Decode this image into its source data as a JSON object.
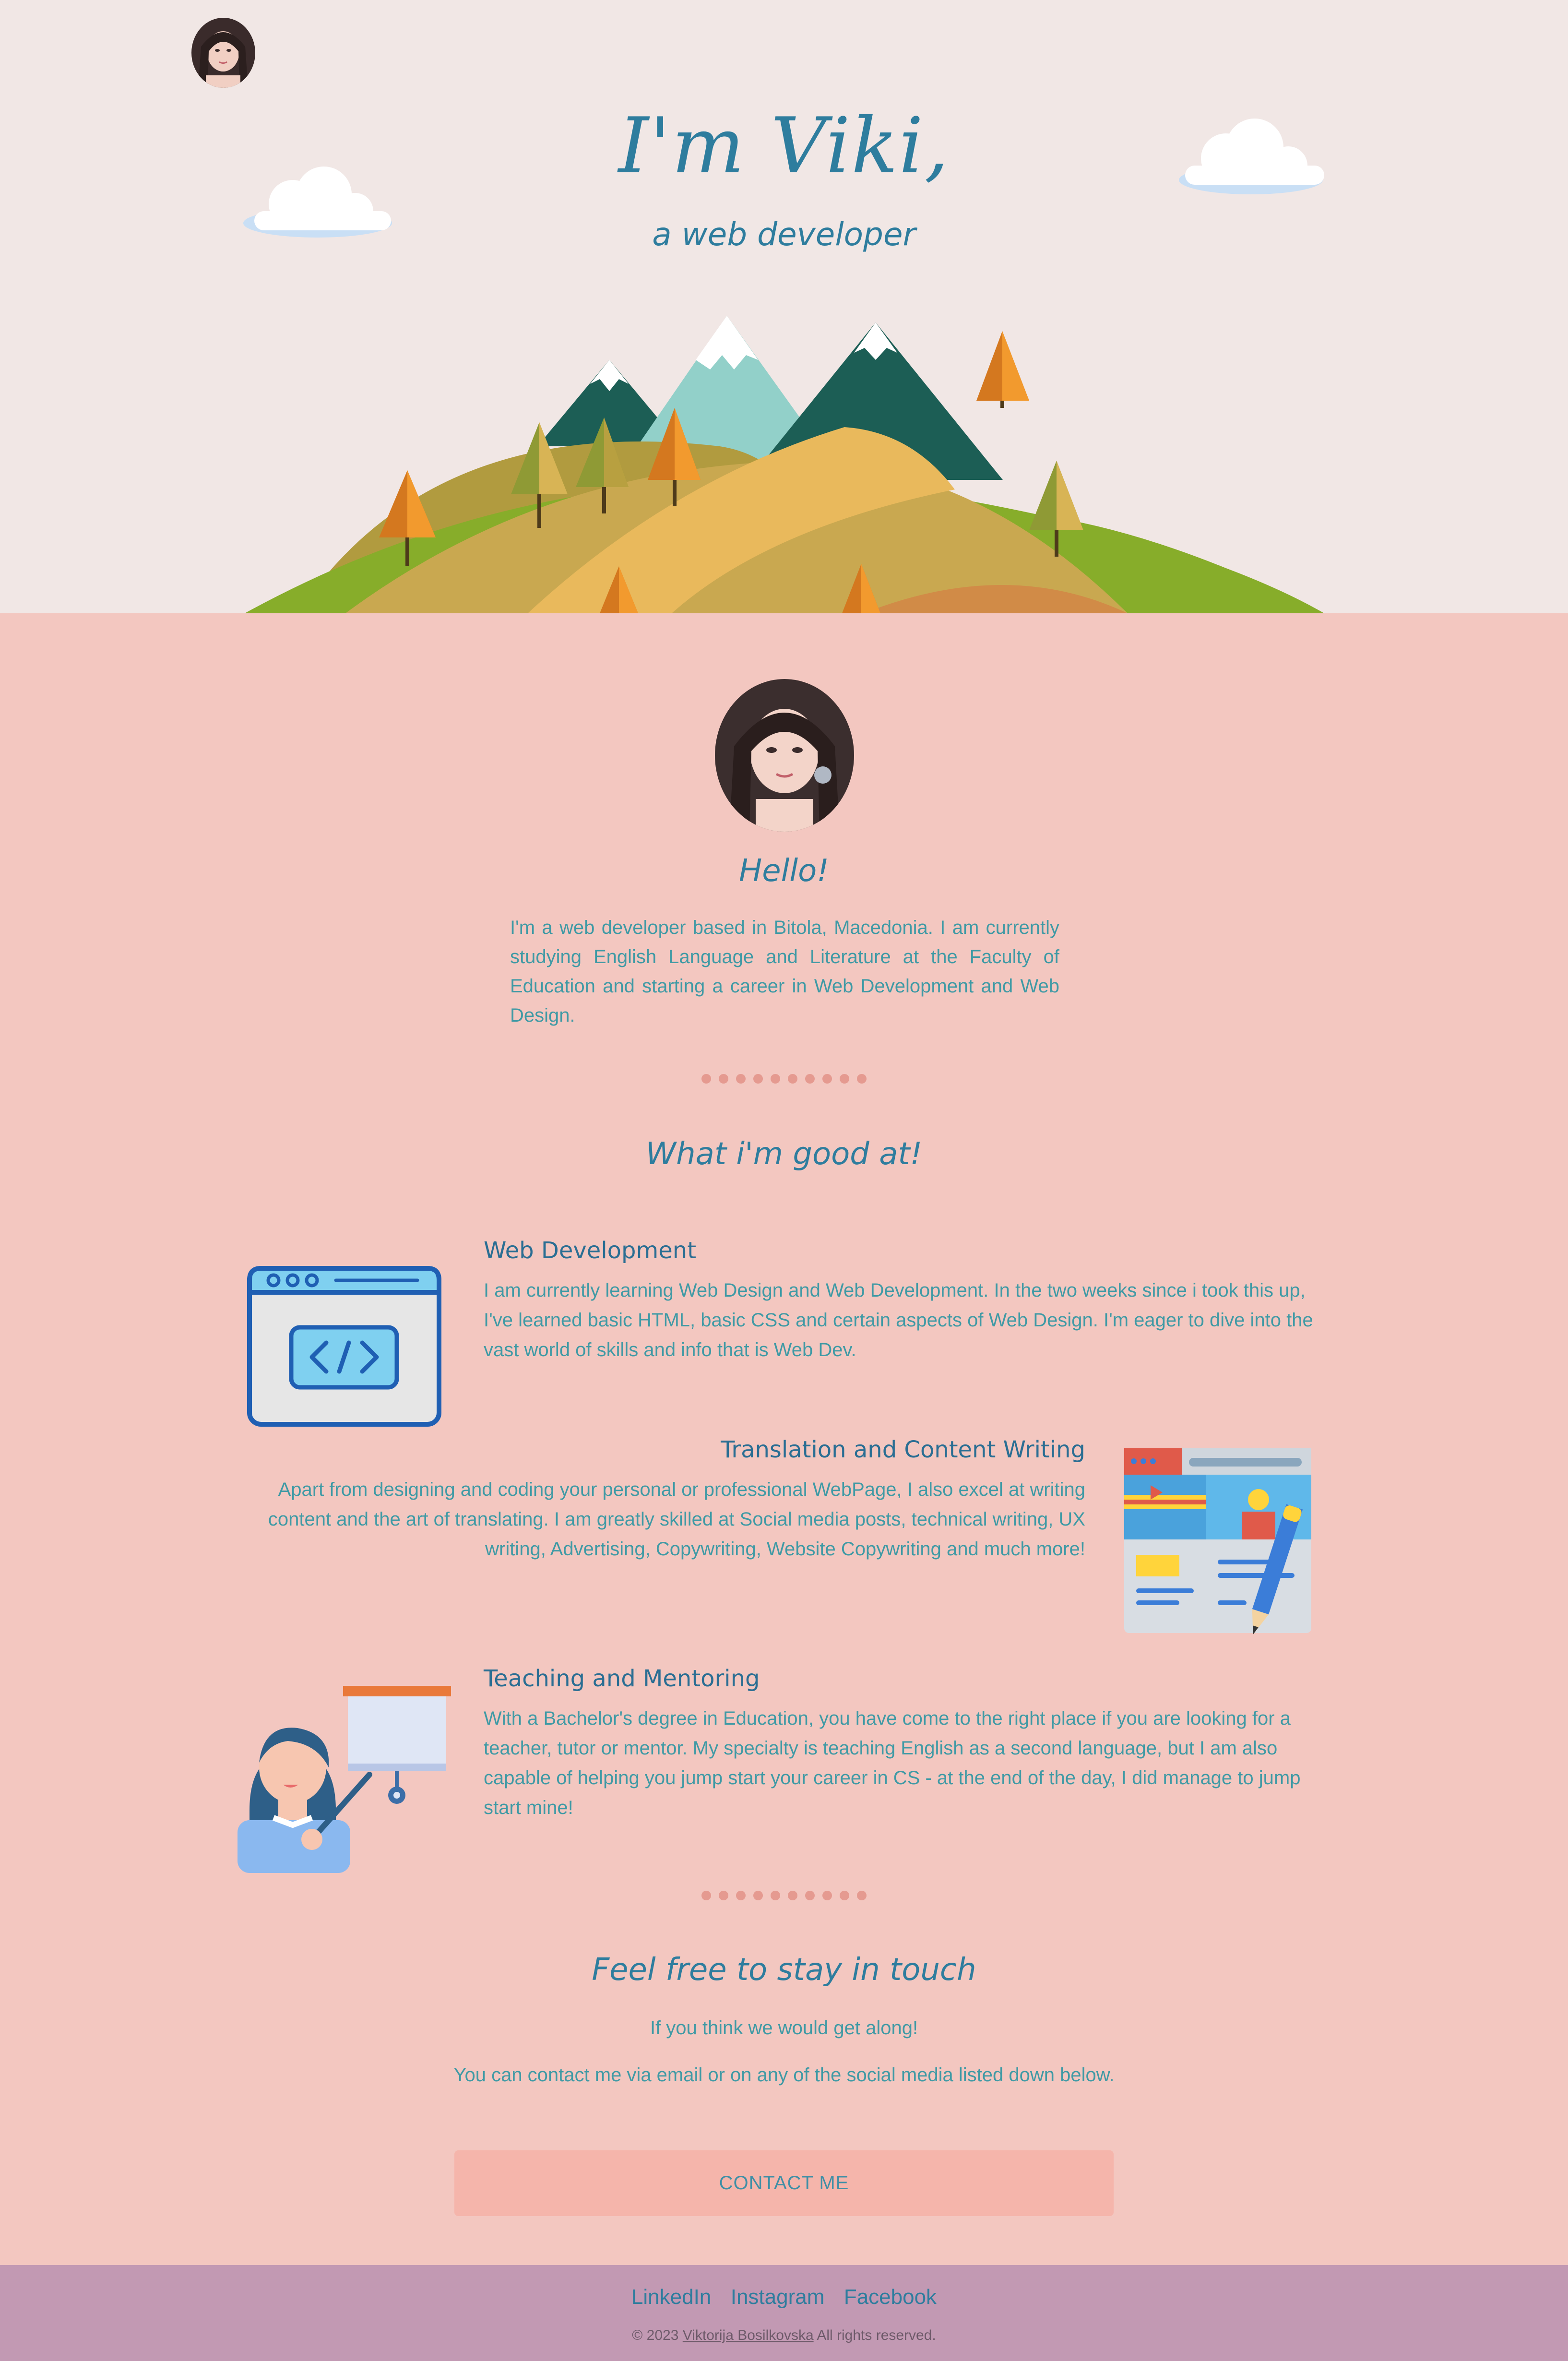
{
  "hero": {
    "title": "I'm Viki,",
    "subtitle": "a web developer"
  },
  "about": {
    "heading": "Hello!",
    "text": "I'm a web developer based in Bitola, Macedonia. I am currently studying English Language and Literature at the Faculty of Education and starting a career in Web Development and Web Design."
  },
  "skills": {
    "heading": "What i'm good at!",
    "items": [
      {
        "title": "Web Development",
        "text": "I am currently learning Web Design and Web Development. In the two weeks since i took this up, I've learned basic HTML, basic CSS and certain aspects of Web Design. I'm eager to dive into the vast world of skills and info that is Web Dev.",
        "icon": "code-window-icon"
      },
      {
        "title": "Translation and Content Writing",
        "text": "Apart from designing and coding your personal or professional WebPage, I also excel at writing content and the art of translating. I am greatly skilled at Social media posts, technical writing, UX writing, Advertising, Copywriting, Website Copywriting and much more!",
        "icon": "content-writing-icon"
      },
      {
        "title": "Teaching and Mentoring",
        "text": "With a Bachelor's degree in Education, you have come to the right place if you are looking for a teacher, tutor or mentor. My specialty is teaching English as a second language, but I am also capable of helping you jump start your career in CS - at the end of the day, I did manage to jump start mine!",
        "icon": "teacher-icon"
      }
    ]
  },
  "contact": {
    "heading": "Feel free to stay in touch",
    "line1": "If you think we would get along!",
    "line2": "You can contact me via email or on any of the social media listed down below.",
    "button_label": "CONTACT ME"
  },
  "footer": {
    "links": [
      "LinkedIn",
      "Instagram",
      "Facebook"
    ],
    "copyright_prefix": "© 2023",
    "author": "Viktorija Bosilkovska",
    "copyright_suffix": "All rights reserved."
  },
  "colors": {
    "hero_bg": "#f1e7e5",
    "content_bg": "#f3c7c0",
    "footer_bg": "#c299b3",
    "heading": "#2e7d9e",
    "body_text": "#3f9aa5",
    "button_bg": "#f5b5ab"
  }
}
